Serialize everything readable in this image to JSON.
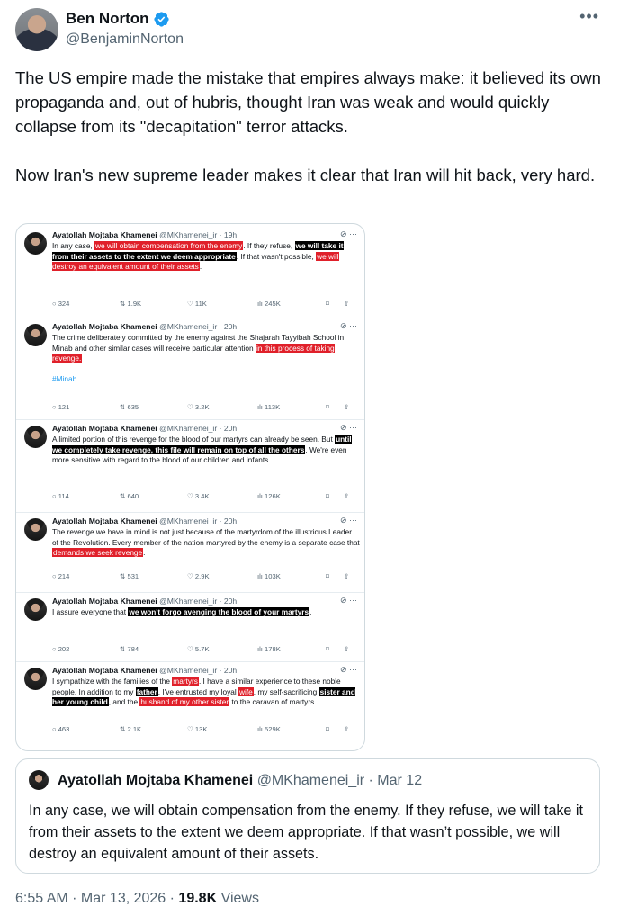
{
  "author": {
    "name": "Ben Norton",
    "handle": "@BenjaminNorton"
  },
  "more_icon": "more-horizontal-icon",
  "tweet": {
    "paragraph1": "The US empire made the mistake that empires always make: it believed its own propaganda and, out of hubris, thought Iran was weak and would quickly collapse from its \"decapitation\" terror attacks.",
    "paragraph2": "Now Iran's new supreme leader makes it clear that Iran will hit back, very hard."
  },
  "media": {
    "tweets": [
      {
        "name": "Ayatollah Mojtaba Khamenei",
        "handle_time": "@MKhamenei_ir · 19h",
        "segments": [
          {
            "t": "In any case, ",
            "s": ""
          },
          {
            "t": "we will obtain compensation from the enemy",
            "s": "red"
          },
          {
            "t": ". If they refuse, ",
            "s": ""
          },
          {
            "t": "we will take it from their assets to the extent we deem appropriate",
            "s": "black"
          },
          {
            "t": ". If that wasn't possible, ",
            "s": ""
          },
          {
            "t": "we will destroy an equivalent amount of their assets",
            "s": "red"
          },
          {
            "t": ".",
            "s": ""
          }
        ],
        "hashtag": "",
        "replies": "324",
        "reposts": "1.9K",
        "likes": "11K",
        "views": "245K"
      },
      {
        "name": "Ayatollah Mojtaba Khamenei",
        "handle_time": "@MKhamenei_ir · 20h",
        "segments": [
          {
            "t": "The crime deliberately committed by the enemy against the Shajarah Tayyibah School in Minab and other similar cases will receive particular attention ",
            "s": ""
          },
          {
            "t": "in this process of taking revenge.",
            "s": "red"
          }
        ],
        "hashtag": "#Minab",
        "replies": "121",
        "reposts": "635",
        "likes": "3.2K",
        "views": "113K"
      },
      {
        "name": "Ayatollah Mojtaba Khamenei",
        "handle_time": "@MKhamenei_ir · 20h",
        "segments": [
          {
            "t": "A limited portion of this revenge for the blood of our martyrs can already be seen. But ",
            "s": ""
          },
          {
            "t": "until we completely take revenge, this file will remain on top of all the others",
            "s": "black"
          },
          {
            "t": ". We're even more sensitive with regard to the blood of our children and infants.",
            "s": ""
          }
        ],
        "hashtag": "",
        "replies": "114",
        "reposts": "640",
        "likes": "3.4K",
        "views": "126K"
      },
      {
        "name": "Ayatollah Mojtaba Khamenei",
        "handle_time": "@MKhamenei_ir · 20h",
        "segments": [
          {
            "t": "The revenge we have in mind is not just because of the martyrdom of the illustrious Leader of the Revolution. Every member of the nation martyred by the enemy is a separate case that ",
            "s": ""
          },
          {
            "t": "demands we seek revenge",
            "s": "red"
          },
          {
            "t": ".",
            "s": ""
          }
        ],
        "hashtag": "",
        "replies": "214",
        "reposts": "531",
        "likes": "2.9K",
        "views": "103K"
      },
      {
        "name": "Ayatollah Mojtaba Khamenei",
        "handle_time": "@MKhamenei_ir · 20h",
        "segments": [
          {
            "t": "I assure everyone that ",
            "s": ""
          },
          {
            "t": "we won't forgo avenging the blood of your martyrs",
            "s": "black"
          },
          {
            "t": ".",
            "s": ""
          }
        ],
        "hashtag": "",
        "replies": "202",
        "reposts": "784",
        "likes": "5.7K",
        "views": "178K"
      },
      {
        "name": "Ayatollah Mojtaba Khamenei",
        "handle_time": "@MKhamenei_ir · 20h",
        "segments": [
          {
            "t": "I sympathize with the families of the ",
            "s": ""
          },
          {
            "t": "martyrs",
            "s": "red"
          },
          {
            "t": ". I have a similar experience to these noble people.  In addition to my ",
            "s": ""
          },
          {
            "t": "father",
            "s": "black"
          },
          {
            "t": ", I've entrusted my loyal ",
            "s": ""
          },
          {
            "t": "wife",
            "s": "red"
          },
          {
            "t": ", my self-sacrificing ",
            "s": ""
          },
          {
            "t": "sister and her young child",
            "s": "black"
          },
          {
            "t": ", and the ",
            "s": ""
          },
          {
            "t": "husband of my other sister",
            "s": "red"
          },
          {
            "t": " to the caravan of martyrs.",
            "s": ""
          }
        ],
        "hashtag": "",
        "replies": "463",
        "reposts": "2.1K",
        "likes": "13K",
        "views": "529K"
      }
    ]
  },
  "quote": {
    "name": "Ayatollah Mojtaba Khamenei",
    "handle_date": "@MKhamenei_ir · Mar 12",
    "text": "In any case, we will obtain compensation from the enemy. If they refuse, we will take it from their assets to the extent we deem appropriate. If that wasn’t possible, we will destroy an equivalent amount of their assets."
  },
  "footer": {
    "time_date": "6:55 AM · Mar 13, 2026 · ",
    "views_count": "19.8K",
    "views_label": " Views"
  },
  "colors": {
    "highlight_red": "#e0202a",
    "highlight_black": "#000000",
    "verified_blue": "#1d9bf0",
    "secondary_text": "#536471"
  }
}
